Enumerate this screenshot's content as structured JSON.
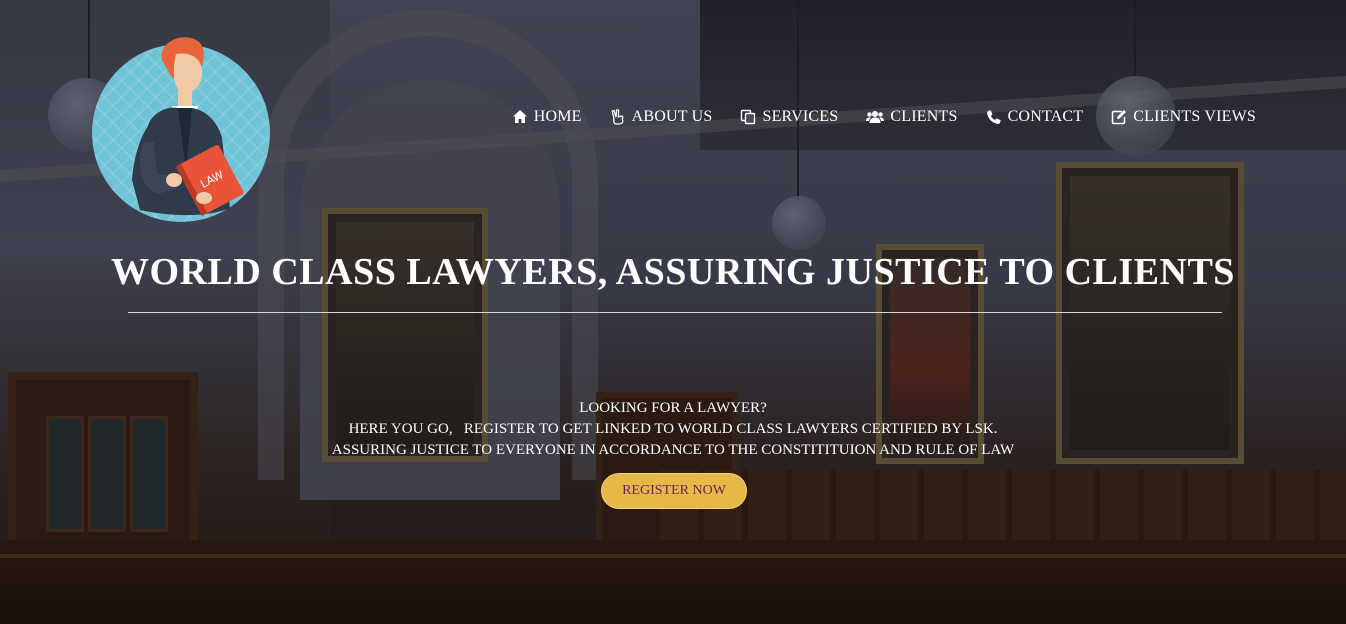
{
  "nav": {
    "items": [
      {
        "label": "HOME",
        "icon": "home-icon"
      },
      {
        "label": "ABOUT US",
        "icon": "peace-hand-icon"
      },
      {
        "label": "SERVICES",
        "icon": "copy-icon"
      },
      {
        "label": "CLIENTS",
        "icon": "users-icon"
      },
      {
        "label": "CONTACT",
        "icon": "phone-icon"
      },
      {
        "label": "CLIENTS VIEWS",
        "icon": "edit-icon"
      }
    ]
  },
  "logo": {
    "book_text": "LAW",
    "colors": {
      "circle": "#6fc3d6",
      "robe": "#2f3a4a",
      "book": "#e8533a",
      "hair": "#e8653c"
    }
  },
  "hero": {
    "title": "WORLD CLASS LAWYERS, ASSURING JUSTICE TO CLIENTS",
    "lines": [
      "LOOKING FOR A LAWYER?",
      "HERE YOU GO,   REGISTER TO GET LINKED TO WORLD CLASS LAWYERS CERTIFIED BY LSK.",
      "ASSURING JUSTICE TO EVERYONE IN ACCORDANCE TO THE CONSTITITUION AND RULE OF LAW"
    ],
    "cta_label": "REGISTER NOW"
  },
  "colors": {
    "cta_bg": "#e6b845",
    "cta_text": "#6b2450",
    "text": "#ffffff"
  }
}
